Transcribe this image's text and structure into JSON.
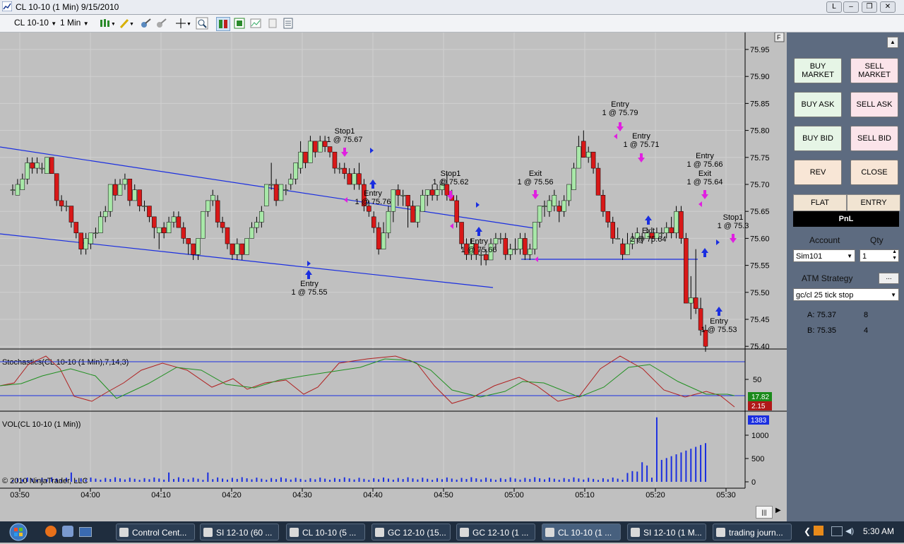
{
  "window": {
    "title": "CL 10-10 (1 Min)  9/15/2010",
    "buttons": [
      "L",
      "–",
      "❐",
      "✕"
    ]
  },
  "toolbar": {
    "instrument": "CL 10-10",
    "interval": "1 Min"
  },
  "chart": {
    "price_ticks": [
      "75.95",
      "75.90",
      "75.85",
      "75.80",
      "75.75",
      "75.70",
      "75.65",
      "75.60",
      "75.55",
      "75.50",
      "75.45",
      "75.40"
    ],
    "time_ticks": [
      "03:50",
      "04:00",
      "04:10",
      "04:20",
      "04:30",
      "04:40",
      "04:50",
      "05:00",
      "05:10",
      "05:20",
      "05:30"
    ],
    "f_button": "F",
    "annotations": [
      {
        "line1": "Stop1",
        "line2": "1 @ 75.67"
      },
      {
        "line1": "Entry",
        "line2": "1 @ 75.76"
      },
      {
        "line1": "Entry",
        "line2": "1 @ 75.55"
      },
      {
        "line1": "Stop1",
        "line2": "1 @ 75.62"
      },
      {
        "line1": "Entry",
        "line2": "1 @ 75.66"
      },
      {
        "line1": "Exit",
        "line2": "1 @ 75.56"
      },
      {
        "line1": "Entry",
        "line2": "1 @ 75.79"
      },
      {
        "line1": "Entry",
        "line2": "1 @ 75.71"
      },
      {
        "line1": "Exit",
        "line2": "2 @ 75.64"
      },
      {
        "line1": "Entry",
        "line2": "1 @ 75.66"
      },
      {
        "line1": "Exit",
        "line2": "1 @ 75.64"
      },
      {
        "line1": "Stop1",
        "line2": "1 @ 75.3"
      },
      {
        "line1": "Entry",
        "line2": "1 @ 75.53"
      }
    ],
    "stochastics_label": "Stochastics(CL 10-10 (1 Min),7,14,3)",
    "stochastics_tick": "50",
    "stoch_values": [
      "17.82",
      "2.15"
    ],
    "volume_label": "VOL(CL 10-10 (1 Min))",
    "volume_ticks": [
      "1000",
      "500",
      "0"
    ],
    "volume_value": "1383",
    "copyright": "© 2010 NinjaTrader, LLC",
    "colors": {
      "bull": "#a8e8a8",
      "bear": "#d81818",
      "trend": "#1a2ee0",
      "stoch_k": "#b02020",
      "stoch_d": "#209020",
      "volume": "#1a2ee0"
    }
  },
  "panel": {
    "buy_market": "BUY MARKET",
    "sell_market": "SELL MARKET",
    "buy_ask": "BUY ASK",
    "sell_ask": "SELL ASK",
    "buy_bid": "BUY BID",
    "sell_bid": "SELL BID",
    "rev": "REV",
    "close": "CLOSE",
    "flat": "FLAT",
    "entry": "ENTRY",
    "pnl": "PnL",
    "account_label": "Account",
    "qty_label": "Qty",
    "account": "Sim101",
    "qty": "1",
    "atm_label": "ATM Strategy",
    "atm_more": "...",
    "atm": "gc/cl 25 tick stop",
    "ask": "A: 75.37",
    "ask_size": "8",
    "bid": "B: 75.35",
    "bid_size": "4"
  },
  "taskbar": {
    "items": [
      "Control Cent...",
      "SI 12-10 (60 ...",
      "CL 10-10 (5 ...",
      "GC 12-10 (15...",
      "GC 12-10 (1 ...",
      "CL 10-10 (1 ...",
      "SI 12-10 (1 M...",
      "trading journ..."
    ],
    "clock": "5:30 AM"
  }
}
